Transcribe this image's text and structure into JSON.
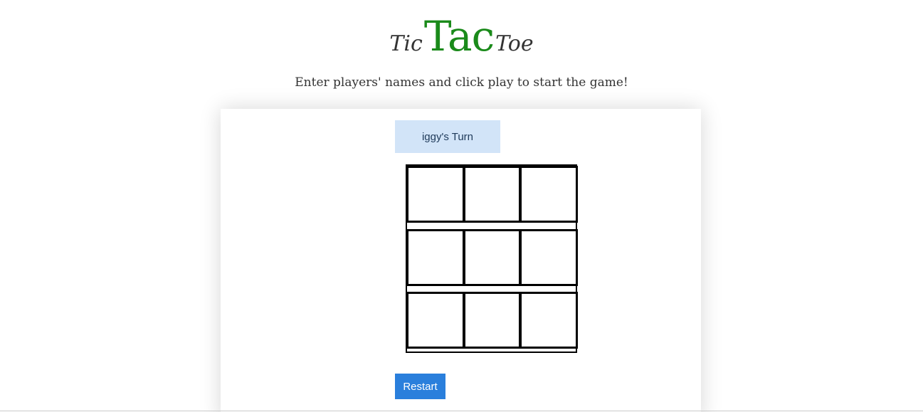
{
  "header": {
    "title_left": "Tic",
    "title_middle": "Tac",
    "title_right": "Toe",
    "subtitle": "Enter players' names and click play to start the game!"
  },
  "game": {
    "turn_label": "iggy's Turn",
    "board": [
      [
        "",
        "",
        ""
      ],
      [
        "",
        "",
        ""
      ],
      [
        "",
        "",
        ""
      ]
    ],
    "restart_label": "Restart"
  },
  "colors": {
    "title_accent": "#1a8a1a",
    "turn_background": "#d2e4f8",
    "restart_background": "#2a7fdc"
  }
}
